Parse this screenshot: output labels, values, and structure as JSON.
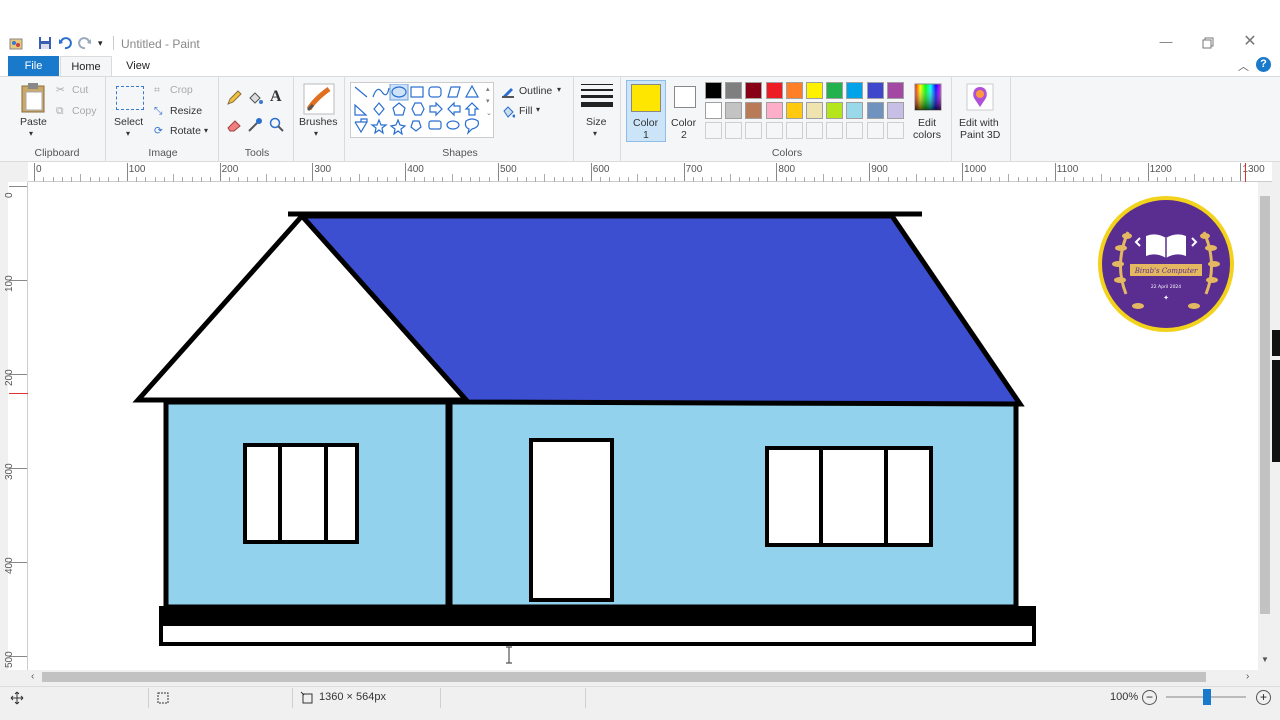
{
  "window": {
    "title": "Untitled - Paint",
    "minimize_icon": "minimize-icon",
    "restore_icon": "restore-icon",
    "close_icon": "close-icon"
  },
  "tabs": [
    {
      "label": "File",
      "active_color": "#1979ca"
    },
    {
      "label": "Home"
    },
    {
      "label": "View"
    }
  ],
  "ribbon": {
    "clipboard": {
      "group_label": "Clipboard",
      "paste": "Paste",
      "cut": "Cut",
      "copy": "Copy"
    },
    "image": {
      "group_label": "Image",
      "select": "Select",
      "crop": "Crop",
      "resize": "Resize",
      "rotate": "Rotate"
    },
    "tools": {
      "group_label": "Tools"
    },
    "brushes": {
      "label": "Brushes"
    },
    "shapes": {
      "group_label": "Shapes",
      "outline": "Outline",
      "fill": "Fill"
    },
    "size": {
      "label": "Size"
    },
    "color1": {
      "label_line1": "Color",
      "label_line2": "1",
      "value": "#ffe600"
    },
    "color2": {
      "label_line1": "Color",
      "label_line2": "2",
      "value": "#ffffff"
    },
    "colors": {
      "group_label": "Colors",
      "edit_line1": "Edit",
      "edit_line2": "colors"
    },
    "paint3d": {
      "line1": "Edit with",
      "line2": "Paint 3D"
    }
  },
  "palette": [
    "#000000",
    "#7f7f7f",
    "#880015",
    "#ed1c24",
    "#ff7f27",
    "#fff200",
    "#22b14c",
    "#00a2e8",
    "#3f48cc",
    "#a349a4",
    "#ffffff",
    "#c3c3c3",
    "#b97a57",
    "#ffaec9",
    "#ffc90e",
    "#efe4b0",
    "#b5e61d",
    "#99d9ea",
    "#7092be",
    "#c8bfe7"
  ],
  "ruler": {
    "h_ticks": [
      "0",
      "100",
      "200",
      "300",
      "400",
      "500",
      "600",
      "700",
      "800",
      "900",
      "1000",
      "1100",
      "1200",
      "1300"
    ],
    "v_ticks": [
      "0",
      "100",
      "200",
      "300",
      "400",
      "500"
    ]
  },
  "drawing": {
    "roof_color": "#3b4fd0",
    "wall_color": "#93d2ec",
    "gable_color": "#ffffff",
    "outline_color": "#000000"
  },
  "logo": {
    "banner_text": "Birab's Computer",
    "date_text": "22 April 2024",
    "bg": "#5a2d91",
    "ring": "#f2d21b"
  },
  "status": {
    "canvas_size": "1360 × 564px",
    "zoom": "100%"
  }
}
